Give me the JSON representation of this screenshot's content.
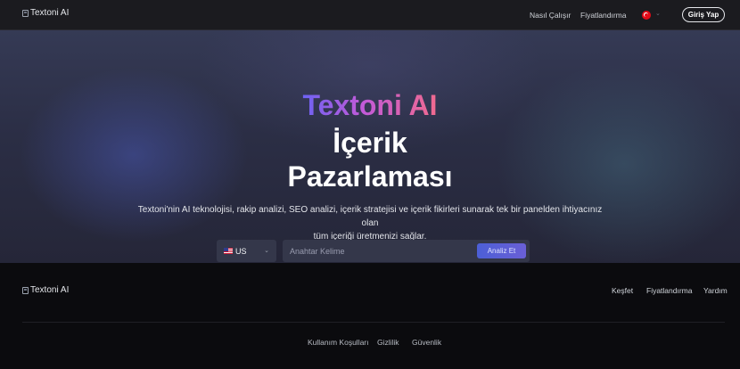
{
  "header": {
    "logo_alt": "Textoni AI",
    "nav": [
      {
        "label": "Nasıl Çalışır"
      },
      {
        "label": "Fiyatlandırma"
      }
    ],
    "language_icon": "turkey-flag-icon",
    "login_label": "Giriş Yap"
  },
  "hero": {
    "title_brand": "Textoni AI",
    "title_line2": "İçerik",
    "title_line3": "Pazarlaması",
    "description_line1": "Textoni'nin AI teknolojisi, rakip analizi, SEO analizi, içerik stratejisi ve içerik fikirleri sunarak tek bir panelden ihtiyacınız olan",
    "description_line2": "tüm içeriği üretmenizi sağlar.",
    "region_value": "US",
    "search_placeholder": "Anahtar Kelime",
    "analyze_label": "Analiz Et"
  },
  "footer": {
    "logo_alt": "Textoni AI",
    "links": [
      {
        "label": "Keşfet"
      },
      {
        "label": "Fiyatlandırma"
      },
      {
        "label": "Yardım"
      }
    ],
    "legal": [
      {
        "label": "Kullanım Koşulları"
      },
      {
        "label": "Gizlilik"
      },
      {
        "label": "Güvenlik"
      }
    ]
  },
  "colors": {
    "accent_start": "#6d62f3",
    "accent_mid": "#c25ad8",
    "accent_end": "#f06a8e",
    "button": "#4c5fd6"
  }
}
